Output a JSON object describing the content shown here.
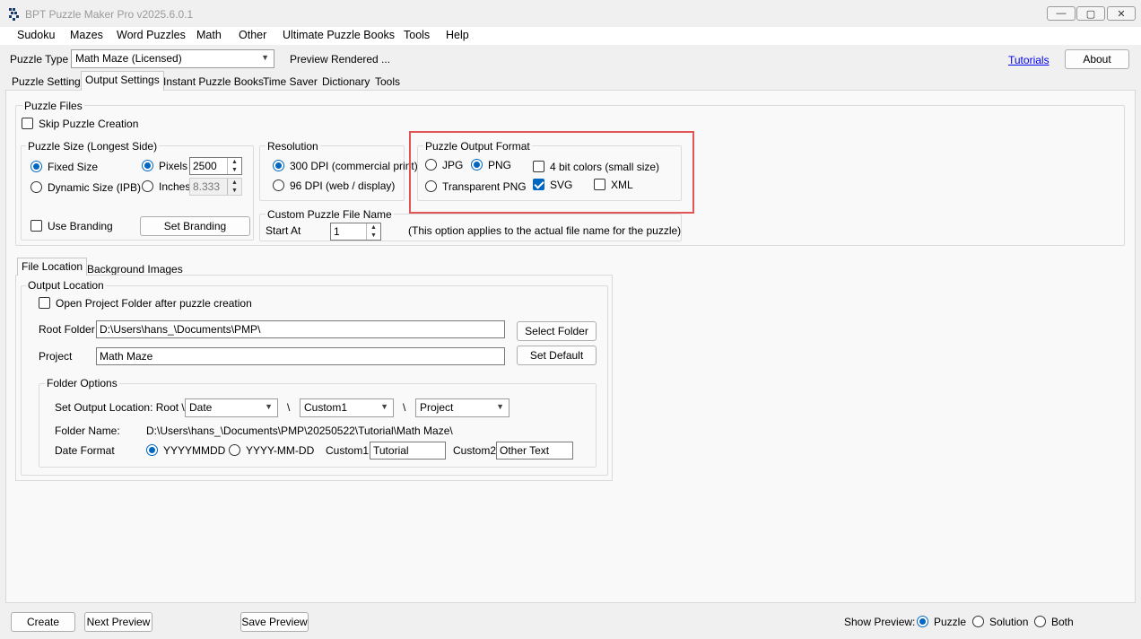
{
  "window": {
    "title": "BPT Puzzle Maker Pro v2025.6.0.1",
    "buttons": [
      "minimize-icon",
      "maximize-icon",
      "close-icon"
    ]
  },
  "menu": [
    "Sudoku",
    "Mazes",
    "Word Puzzles",
    "Math",
    "Other",
    "Ultimate Puzzle Books",
    "Tools",
    "Help"
  ],
  "toolbar": {
    "puzzle_type_label": "Puzzle Type",
    "puzzle_type_value": "Math Maze (Licensed)",
    "preview_status": "Preview Rendered ...",
    "tutorials_link": "Tutorials",
    "about_button": "About"
  },
  "tabs": [
    "Puzzle Settings",
    "Output Settings",
    "Instant Puzzle Books",
    "Time Saver",
    "Dictionary",
    "Tools"
  ],
  "active_tab": "Output Settings",
  "puzzle_files": {
    "title": "Puzzle Files",
    "skip_label": "Skip Puzzle Creation",
    "size": {
      "title": "Puzzle Size (Longest Side)",
      "fixed": "Fixed Size",
      "dynamic": "Dynamic Size (IPB)",
      "pixels": "Pixels",
      "pixels_value": "2500",
      "inches": "Inches",
      "inches_value": "8.333",
      "use_branding": "Use Branding",
      "set_branding": "Set Branding"
    },
    "resolution": {
      "title": "Resolution",
      "dpi300": "300 DPI (commercial print)",
      "dpi96": "96  DPI (web / display)"
    },
    "output_format": {
      "title": "Puzzle Output Format",
      "jpg": "JPG",
      "png": "PNG",
      "transparent_png": "Transparent PNG",
      "four_bit": "4 bit colors (small size)",
      "svg": "SVG",
      "xml": "XML",
      "highlight_color": "#e05555"
    },
    "custom_name": {
      "title": "Custom Puzzle File Name",
      "start_at": "Start At",
      "start_value": "1",
      "note": "(This option applies to the actual file name for the puzzle)"
    }
  },
  "lower_tabs": [
    "File Location",
    "Background Images"
  ],
  "output_location": {
    "title": "Output Location",
    "open_folder": "Open Project Folder after puzzle creation",
    "root_label": "Root Folder",
    "root_value": "D:\\Users\\hans_\\Documents\\PMP\\",
    "select_folder": "Select Folder",
    "project_label": "Project",
    "project_value": "Math Maze",
    "set_default": "Set Default",
    "folder_options": {
      "title": "Folder Options",
      "set_output_label": "Set Output Location: Root \\",
      "combo1": "Date",
      "sep1": "\\",
      "combo2": "Custom1",
      "sep2": "\\",
      "combo3": "Project",
      "folder_name_label": "Folder Name:",
      "folder_name_value": "D:\\Users\\hans_\\Documents\\PMP\\20250522\\Tutorial\\Math Maze\\",
      "date_format_label": "Date Format",
      "fmt1": "YYYYMMDD",
      "fmt2": "YYYY-MM-DD",
      "custom1_label": "Custom1:",
      "custom1_value": "Tutorial",
      "custom2_label": "Custom2:",
      "custom2_value": "Other Text"
    }
  },
  "bottom": {
    "create": "Create",
    "next_preview": "Next Preview",
    "save_preview": "Save Preview",
    "show_preview_label": "Show Preview:",
    "puzzle": "Puzzle",
    "solution": "Solution",
    "both": "Both"
  },
  "accent_color": "#0067c0"
}
